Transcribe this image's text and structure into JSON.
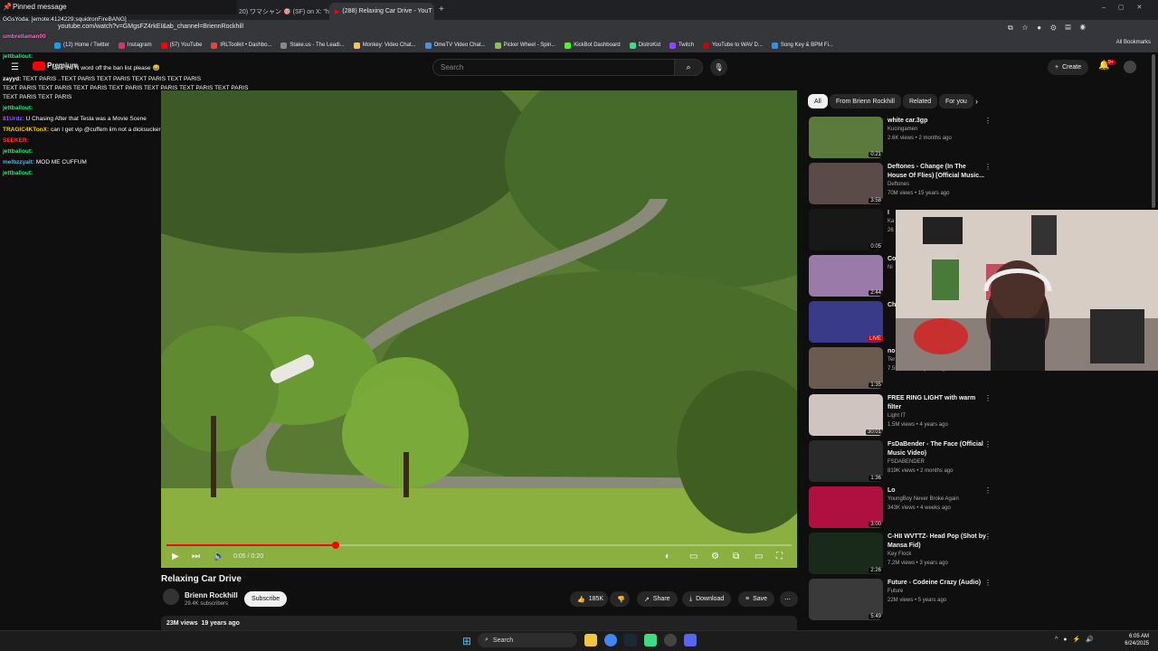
{
  "browser": {
    "tabs": [
      {
        "label": "20) ワマシャン 🎯 (SF) on X: \"http",
        "active": false
      },
      {
        "label": "(288) Relaxing Car Drive - YouT",
        "active": true
      }
    ],
    "new_tab_label": "+",
    "url": "youtube.com/watch?v=GMgsFZ4rkEI&ab_channel=BriennRockhill",
    "bookmarks": [
      {
        "label": "(12) Home / Twitter",
        "color": "#1d9bf0"
      },
      {
        "label": "Instagram",
        "color": "#e1306c"
      },
      {
        "label": "(57) YouTube",
        "color": "#ff0000"
      },
      {
        "label": "IRLToolkit • Dashbo...",
        "color": "#f04040"
      },
      {
        "label": "Stake.us - The Leadi...",
        "color": "#888888"
      },
      {
        "label": "Monkey: Video Chat...",
        "color": "#f7c948"
      },
      {
        "label": "OmeTV Video Chat...",
        "color": "#4a90e2"
      },
      {
        "label": "Picker Wheel - Spin...",
        "color": "#8bc34a"
      },
      {
        "label": "KickBot Dashboard",
        "color": "#53fc18"
      },
      {
        "label": "DistroKid",
        "color": "#3ddc84"
      },
      {
        "label": "Twitch",
        "color": "#9146ff"
      },
      {
        "label": "YouTube to WAV D...",
        "color": "#cc0000"
      },
      {
        "label": "Song Key & BPM Fi...",
        "color": "#2196f3"
      }
    ],
    "all_bookmarks": "All Bookmarks"
  },
  "youtube": {
    "logo_text": "Premium",
    "search_placeholder": "Search",
    "create_label": "Create",
    "notification_count": "9+",
    "chips": [
      "All",
      "From Brienn Rockhill",
      "Related",
      "For you"
    ],
    "video": {
      "time_current": "0:05",
      "time_total": "0:20",
      "progress_fraction": 0.27,
      "title": "Relaxing Car Drive",
      "channel": "Brienn Rockhill",
      "subscribers": "29.4K subscribers",
      "subscribe_label": "Subscribe",
      "likes": "185K",
      "share_label": "Share",
      "download_label": "Download",
      "save_label": "Save",
      "views": "23M views",
      "age": "19 years ago"
    },
    "recommended": [
      {
        "title": "white car.3gp",
        "channel": "Kucingamen",
        "meta": "2.6K views • 2 months ago",
        "duration": "0:21",
        "color": "#5c7a3c"
      },
      {
        "title": "Deftones - Change (In The House Of Flies) [Official Music...",
        "channel": "Deftones",
        "meta": "70M views • 15 years ago",
        "duration": "3:58",
        "color": "#5a4a48"
      },
      {
        "title": "I",
        "channel": "Ka",
        "meta": "26",
        "duration": "0:05",
        "color": "#181818"
      },
      {
        "title": "Co",
        "channel": "Ni",
        "meta": "",
        "duration": "2:44",
        "color": "#9a7aa8"
      },
      {
        "title": "Ch",
        "channel": "",
        "meta": "",
        "duration": "LIVE",
        "color": "#3a3a8a"
      },
      {
        "title": "no",
        "channel": "Ter",
        "meta": "7.5M views • 4 years ago",
        "duration": "1:35",
        "color": "#6a5a50"
      },
      {
        "title": "FREE RING LIGHT with warm filter",
        "channel": "Light IT",
        "meta": "1.5M views • 4 years ago",
        "duration": "30:01",
        "color": "#cfc4c0"
      },
      {
        "title": "FsDaBender - The Face (Official Music Video)",
        "channel": "FSDABENDER",
        "meta": "819K views • 2 months ago",
        "duration": "1:36",
        "color": "#2a2a2a"
      },
      {
        "title": "Lo",
        "channel": "YoungBoy Never Broke Again",
        "meta": "343K views • 4 weeks ago",
        "duration": "3:00",
        "color": "#b01040"
      },
      {
        "title": "C-HII WVTTZ- Head Pop (Shot by Mansa Fid)",
        "channel": "Key Flock",
        "meta": "7.2M views • 3 years ago",
        "duration": "2:26",
        "color": "#1a2a1a"
      },
      {
        "title": "Future - Codeine Crazy (Audio)",
        "channel": "Future",
        "meta": "22M views • 5 years ago",
        "duration": "5:49",
        "color": "#3a3a3a"
      }
    ]
  },
  "chat": {
    "pinned_label": "Pinned message",
    "pinned_line": "GGsYoda: [emote:4124229:squidronFireBANG]",
    "lines": [
      {
        "user": "umbrellaman00",
        "text": "",
        "color": "#ff6ec7"
      },
      {
        "user": "",
        "text": "take the N word off the ban list please 😅",
        "color": "#ffffff"
      },
      {
        "user": "jettballout:",
        "text": "",
        "color": "#00ff7f"
      },
      {
        "user": "zayyd:",
        "text": "TEXT PARIS ..TEXT PARIS TEXT PARIS TEXT PARIS TEXT PARIS",
        "color": "#ffffff"
      },
      {
        "user": "",
        "text": "TEXT PARIS TEXT PARIS TEXT PARIS TEXT PARIS TEXT PARIS TEXT PARIS TEXT PARIS",
        "color": "#ffffff"
      },
      {
        "user": "",
        "text": "TEXT PARIS TEXT PARIS",
        "color": "#ffffff"
      },
      {
        "user": "jettballout:",
        "text": "",
        "color": "#00ff7f"
      },
      {
        "user": "81Urdz:",
        "text": "U Chasing After that Tesla was a Movie Scene",
        "color": "#9b59ff"
      },
      {
        "user": "TRAGIC4KTonX:",
        "text": "can I get vip @cuffem iim not a dicksucker",
        "color": "#ffcc00"
      },
      {
        "user": "SEEKER:",
        "text": "",
        "color": "#ff4040"
      },
      {
        "user": "jettballout:",
        "text": "",
        "color": "#00ff7f"
      },
      {
        "user": "melbzzyalt:",
        "text": "MOD ME CUFFUM",
        "color": "#40c0ff"
      },
      {
        "user": "jettballout:",
        "text": "",
        "color": "#00ff7f"
      }
    ]
  },
  "taskbar": {
    "search_label": "Search",
    "time": "6:05 AM",
    "date": "6/24/2025"
  }
}
